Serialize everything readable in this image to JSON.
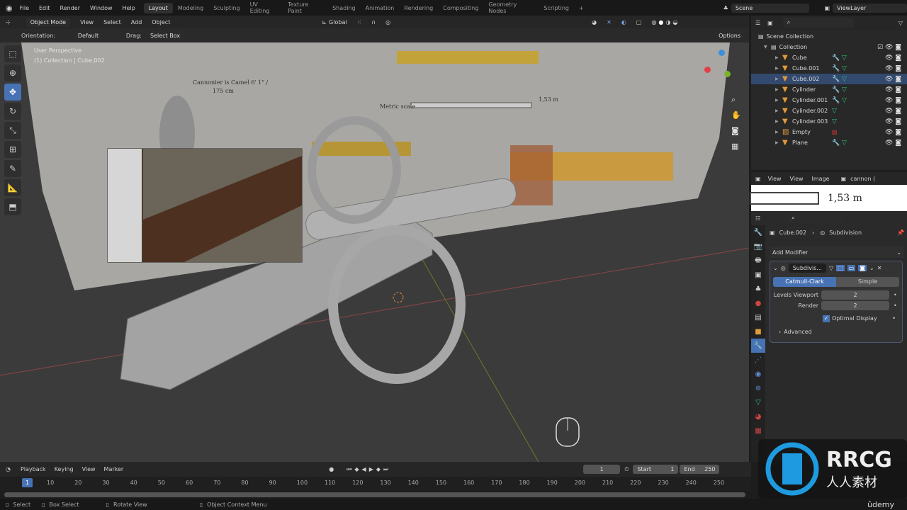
{
  "topbar": {
    "menus": [
      "File",
      "Edit",
      "Render",
      "Window",
      "Help"
    ],
    "workspaces": [
      "Layout",
      "Modeling",
      "Sculpting",
      "UV Editing",
      "Texture Paint",
      "Shading",
      "Animation",
      "Rendering",
      "Compositing",
      "Geometry Nodes",
      "Scripting"
    ],
    "active_workspace": "Layout",
    "add_tab": "+",
    "scene": "Scene",
    "view_layer": "ViewLayer"
  },
  "viewport_header": {
    "mode": "Object Mode",
    "menus": [
      "View",
      "Select",
      "Add",
      "Object"
    ],
    "transform_orientation": "Global"
  },
  "tool_settings": {
    "orientation_label": "Orientation:",
    "orientation": "Default",
    "drag_label": "Drag:",
    "drag": "Select Box",
    "options": "Options"
  },
  "viewport": {
    "view_name": "User Perspective",
    "context": "(1) Collection | Cube.002",
    "reference_texts": {
      "cannonier": "Cannonier is Camel 6' 1\" /",
      "cannonier_cm": "175 cm",
      "metric_scale": "Metric scale",
      "scale_value": "1,53 m"
    },
    "gizmo_axes": [
      "X",
      "Y",
      "Z"
    ],
    "tools": [
      "select-box",
      "cursor",
      "move",
      "rotate",
      "scale",
      "transform",
      "annotate",
      "measure",
      "add-cube"
    ],
    "active_tool": "move"
  },
  "outliner": {
    "root": "Scene Collection",
    "collection": "Collection",
    "items": [
      {
        "name": "Cube",
        "type": "mesh",
        "modifier": true
      },
      {
        "name": "Cube.001",
        "type": "mesh",
        "modifier": true
      },
      {
        "name": "Cube.002",
        "type": "mesh",
        "modifier": true,
        "selected": true
      },
      {
        "name": "Cylinder",
        "type": "mesh",
        "modifier": true
      },
      {
        "name": "Cylinder.001",
        "type": "mesh",
        "modifier": true
      },
      {
        "name": "Cylinder.002",
        "type": "mesh",
        "modifier": false
      },
      {
        "name": "Cylinder.003",
        "type": "mesh",
        "modifier": false
      },
      {
        "name": "Empty",
        "type": "image",
        "modifier": false
      },
      {
        "name": "Plane",
        "type": "mesh",
        "modifier": true
      }
    ]
  },
  "image_editor": {
    "view_menu": "View",
    "menus": [
      "View",
      "Image"
    ],
    "image_name": "cannon (",
    "scale_text": "1,53 m"
  },
  "properties": {
    "breadcrumb_object": "Cube.002",
    "breadcrumb_modifier": "Subdivision",
    "add_modifier": "Add Modifier",
    "modifier": {
      "name": "Subdivis...",
      "types": [
        "Catmull-Clark",
        "Simple"
      ],
      "active_type": "Catmull-Clark",
      "levels_viewport_label": "Levels Viewport",
      "levels_viewport": "2",
      "render_label": "Render",
      "render": "2",
      "optimal_display_label": "Optimal Display",
      "optimal_display": true,
      "advanced": "Advanced"
    }
  },
  "timeline": {
    "menus": [
      "Playback",
      "Keying",
      "View",
      "Marker"
    ],
    "current_frame": "1",
    "start_label": "Start",
    "start": "1",
    "end_label": "End",
    "end": "250",
    "ticks": [
      "10",
      "20",
      "30",
      "40",
      "50",
      "60",
      "70",
      "80",
      "90",
      "100",
      "110",
      "120",
      "130",
      "140",
      "150",
      "160",
      "170",
      "180",
      "190",
      "200",
      "210",
      "220",
      "230",
      "240",
      "250"
    ]
  },
  "statusbar": {
    "select": "Select",
    "box_select": "Box Select",
    "rotate_view": "Rotate View",
    "context_menu": "Object Context Menu"
  },
  "watermark": {
    "brand": "RRCG",
    "brand_cn": "人人素材",
    "udemy": "ûdemy"
  },
  "colors": {
    "accent": "#4772b3",
    "x_axis": "#e0404a",
    "y_axis": "#7ab32c",
    "z_axis": "#3b8fdc",
    "object_orange": "#e39a3a",
    "mesh_green": "#2ec27e"
  }
}
